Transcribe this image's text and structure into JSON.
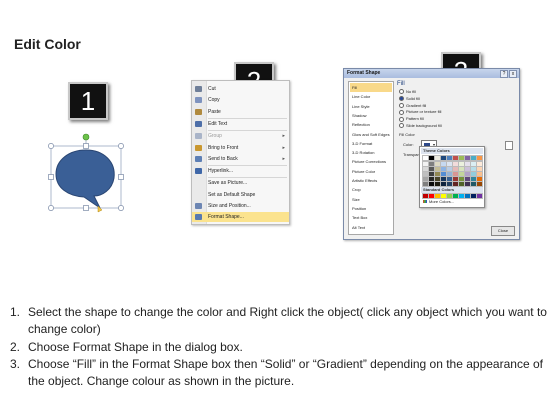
{
  "title": "Edit Color",
  "steps": {
    "badge1": "1",
    "badge2": "2",
    "badge3": "3"
  },
  "context_menu": {
    "items": [
      {
        "label": "Cut",
        "icon": "scissors-icon",
        "color": "#6f7f99"
      },
      {
        "label": "Copy",
        "icon": "copy-icon",
        "color": "#7e93bf"
      },
      {
        "label": "Paste",
        "icon": "paste-icon",
        "color": "#b08a3e"
      },
      {
        "label": "Edit Text",
        "icon": "edit-text-icon",
        "color": "#4e6fa8"
      },
      {
        "label": "Group",
        "icon": "group-icon",
        "color": "#a9b4c8",
        "disabled": true,
        "submenu": true
      },
      {
        "label": "Bring to Front",
        "icon": "bring-front-icon",
        "color": "#c9972f",
        "submenu": true
      },
      {
        "label": "Send to Back",
        "icon": "send-back-icon",
        "color": "#5d7fb5",
        "submenu": true
      },
      {
        "label": "Hyperlink...",
        "icon": "hyperlink-icon",
        "color": "#3f67a8"
      },
      {
        "label": "Save as Picture...",
        "icon": "",
        "color": ""
      },
      {
        "label": "Set as Default Shape",
        "icon": "",
        "color": ""
      },
      {
        "label": "Size and Position...",
        "icon": "size-position-icon",
        "color": "#6d86b3"
      },
      {
        "label": "Format Shape...",
        "icon": "format-shape-icon",
        "color": "#5879b0",
        "highlighted": true
      }
    ],
    "submenu_glyph": "▸"
  },
  "format_dialog": {
    "title": "Format Shape",
    "help_glyph": "?",
    "close_glyph": "x",
    "categories": [
      "Fill",
      "Line Color",
      "Line Style",
      "Shadow",
      "Reflection",
      "Glow and Soft Edges",
      "3-D Format",
      "3-D Rotation",
      "Picture Corrections",
      "Picture Color",
      "Artistic Effects",
      "Crop",
      "Size",
      "Position",
      "Text Box",
      "Alt Text"
    ],
    "selected_category": "Fill",
    "fill_heading": "Fill",
    "fill_options": [
      {
        "label": "No fill",
        "selected": false
      },
      {
        "label": "Solid fill",
        "selected": true
      },
      {
        "label": "Gradient fill",
        "selected": false
      },
      {
        "label": "Picture or texture fill",
        "selected": false
      },
      {
        "label": "Pattern fill",
        "selected": false
      },
      {
        "label": "Slide background fill",
        "selected": false
      }
    ],
    "fill_color_label": "Fill Color",
    "color_label": "Color:",
    "transparency_label": "Transparency:",
    "color_caret": "▾",
    "close_button": "Close"
  },
  "color_popup": {
    "theme_header": "Theme Colors",
    "standard_header": "Standard Colors",
    "more_colors": "More Colors...",
    "theme_top": [
      "#ffffff",
      "#000000",
      "#eeece1",
      "#1f497d",
      "#4f81bd",
      "#c0504d",
      "#9bbb59",
      "#8064a2",
      "#4bacc6",
      "#f79646"
    ],
    "theme_shades": [
      [
        "#f2f2f2",
        "#7f7f7f",
        "#ddd9c3",
        "#c6d9f0",
        "#dbe5f1",
        "#f2dcdb",
        "#ebf1dd",
        "#e5e0ec",
        "#dbeef3",
        "#fdeada"
      ],
      [
        "#d8d8d8",
        "#595959",
        "#c4bd97",
        "#8db3e2",
        "#b8cce4",
        "#e5b9b7",
        "#d7e3bc",
        "#ccc1d9",
        "#b7dde8",
        "#fbd5b5"
      ],
      [
        "#bfbfbf",
        "#3f3f3f",
        "#938953",
        "#548dd4",
        "#95b3d7",
        "#d99694",
        "#c3d69b",
        "#b2a2c7",
        "#92cddc",
        "#fac08f"
      ],
      [
        "#a5a5a5",
        "#262626",
        "#494429",
        "#17365d",
        "#366092",
        "#953734",
        "#76923c",
        "#5f497a",
        "#31859b",
        "#e36c09"
      ],
      [
        "#7f7f7f",
        "#0c0c0c",
        "#1d1b10",
        "#0f243e",
        "#244061",
        "#632423",
        "#4f6128",
        "#3f3151",
        "#205867",
        "#974806"
      ]
    ],
    "standard": [
      "#c00000",
      "#ff0000",
      "#ffc000",
      "#ffff00",
      "#92d050",
      "#00b050",
      "#00b0f0",
      "#0070c0",
      "#002060",
      "#7030a0"
    ]
  },
  "shape": {
    "fill": "#3a5f96",
    "handle_rotate": "#6cc24a"
  },
  "instructions": [
    {
      "num": "1.",
      "text": "Select the shape to change the color and Right click the object( click any object which you want to change color)"
    },
    {
      "num": "2.",
      "text": "Choose Format Shape in the dialog box."
    },
    {
      "num": "3.",
      "text": "Choose “Fill” in the Format Shape box then “Solid” or “Gradient” depending on the appearance of the object. Change colour as shown in the picture."
    }
  ]
}
